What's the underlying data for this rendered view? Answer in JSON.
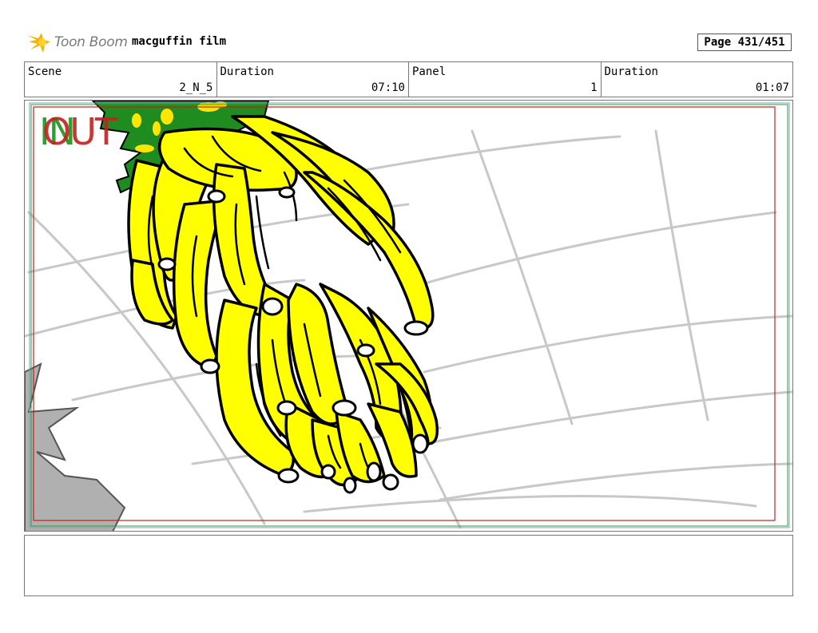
{
  "header": {
    "logo_text": "Toon Boom",
    "project_title": "macguffin film",
    "page_label": "Page 431/451"
  },
  "info": [
    {
      "label": "Scene",
      "value": "2_N_5"
    },
    {
      "label": "Duration",
      "value": "07:10"
    },
    {
      "label": "Panel",
      "value": "1"
    },
    {
      "label": "Duration",
      "value": "01:07"
    }
  ],
  "panel": {
    "in_marker": "IN",
    "out_marker": "OUT"
  },
  "colors": {
    "banana_yellow": "#ffff00",
    "leaf_green": "#1e8c1e",
    "safe_frame_red": "#c42020",
    "safe_frame_green": "#2e9e2e",
    "grid_gray": "#c8c8c8",
    "rock_gray": "#b0b0b0"
  },
  "notes": ""
}
